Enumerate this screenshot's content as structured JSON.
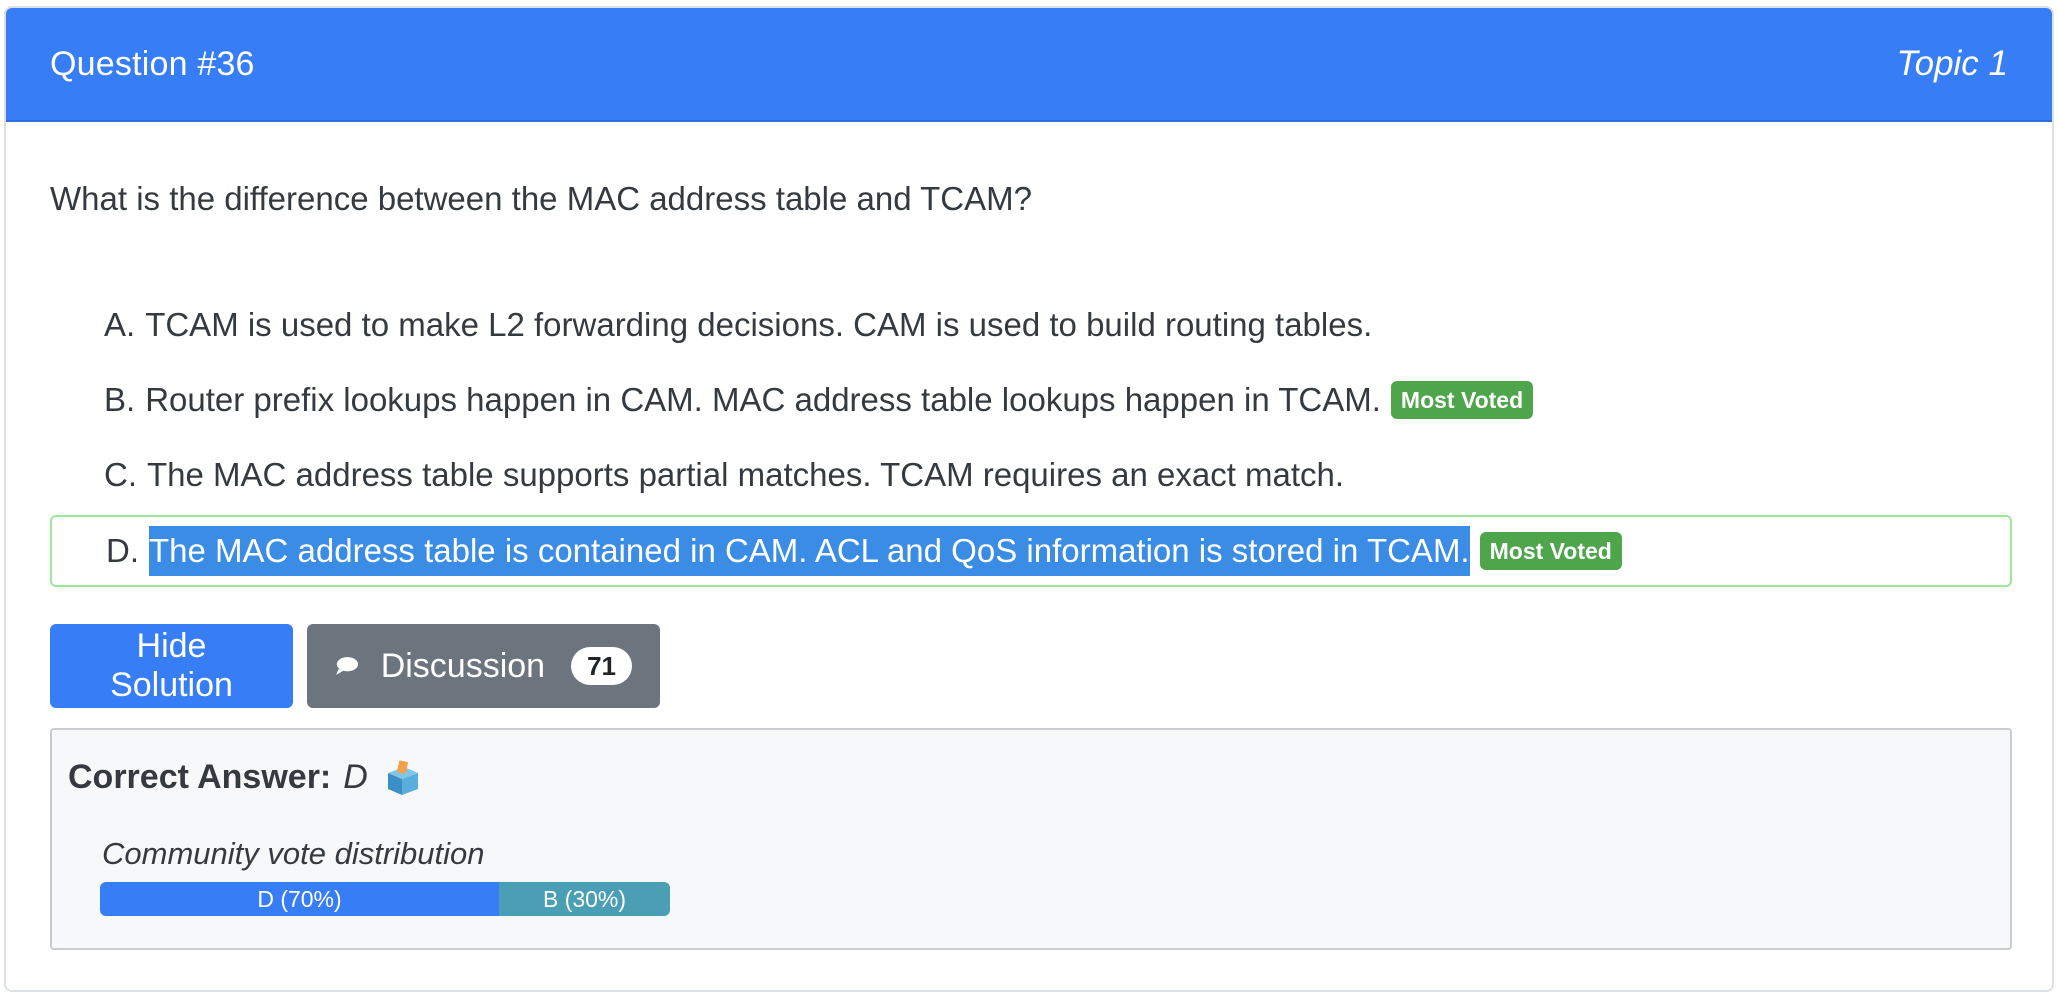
{
  "header": {
    "question_number": "Question #36",
    "topic": "Topic 1"
  },
  "question": {
    "text": "What is the difference between the MAC address table and TCAM?"
  },
  "choices": [
    {
      "letter": "A.",
      "text": "TCAM is used to make L2 forwarding decisions. CAM is used to build routing tables.",
      "badge": ""
    },
    {
      "letter": "B.",
      "text": "Router prefix lookups happen in CAM. MAC address table lookups happen in TCAM.",
      "badge": "Most Voted"
    },
    {
      "letter": "C.",
      "text": "The MAC address table supports partial matches. TCAM requires an exact match.",
      "badge": ""
    },
    {
      "letter": "D.",
      "text": "The MAC address table is contained in CAM. ACL and QoS information is stored in TCAM.",
      "badge": "Most Voted"
    }
  ],
  "actions": {
    "hide_solution_label": "Hide Solution",
    "discussion_label": "Discussion",
    "discussion_count": "71"
  },
  "answer": {
    "label": "Correct Answer:",
    "value": "D",
    "vote_title": "Community vote distribution",
    "votes": [
      {
        "label": "D (70%)",
        "share": 70,
        "color": "#377df5"
      },
      {
        "label": "B (30%)",
        "share": 30,
        "color": "#4a9fb5"
      }
    ]
  },
  "icons": {
    "discussion": "chat-bubble-icon",
    "answer": "ballot-box-icon"
  },
  "colors": {
    "header": "#377df5",
    "badge": "#4ea54b",
    "secondary_button": "#6c757d",
    "selection": "#3b8ce5"
  }
}
